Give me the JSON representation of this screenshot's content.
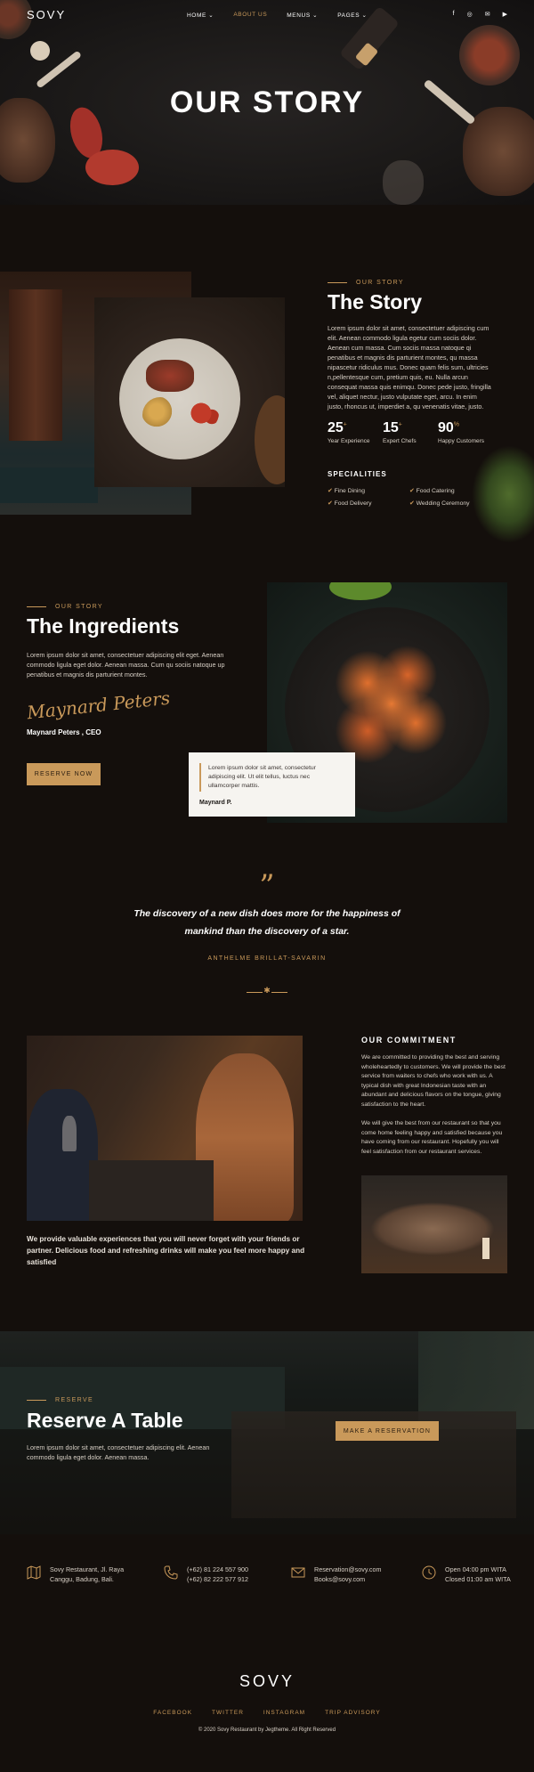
{
  "nav": {
    "logo": "SOVY",
    "items": [
      {
        "label": "HOME ⌄",
        "active": false
      },
      {
        "label": "ABOUT US",
        "active": true
      },
      {
        "label": "MENUS ⌄",
        "active": false
      },
      {
        "label": "PAGES ⌄",
        "active": false
      }
    ],
    "socials": [
      "f",
      "◎",
      "✉",
      "▶"
    ]
  },
  "hero": {
    "title": "OUR STORY"
  },
  "story": {
    "label": "OUR STORY",
    "title": "The Story",
    "text": "Lorem ipsum dolor sit amet, consectetuer adipiscing cum elit. Aenean commodo ligula egetur cum sociis dolor. Aenean cum massa. Cum sociis massa natoque qi penatibus et magnis dis parturient montes, qu massa nipascetur ridiculus mus. Donec quam felis sum, ultricies n,pellentesque cum, pretium quis, eu. Nulla arcun consequat massa quis enimqu. Donec pede justo, fringilla vel, aliquet nectur, justo vulputate eget, arcu. In enim justo, rhoncus ut, imperdiet a, qu venenatis vitae, justo.",
    "stats": [
      {
        "value": "25",
        "suffix": "+",
        "label": "Year Experience"
      },
      {
        "value": "15",
        "suffix": "+",
        "label": "Expert Chefs"
      },
      {
        "value": "90",
        "suffix": "%",
        "label": "Happy Customers"
      }
    ],
    "specialities_title": "SPECIALITIES",
    "specialities": [
      "Fine Dining",
      "Food Catering",
      "Food Delivery",
      "Wedding Ceremony"
    ]
  },
  "ingredients": {
    "label": "OUR STORY",
    "title": "The Ingredients",
    "text": "Lorem ipsum dolor sit amet, consectetuer adipiscing elit eget. Aenean commodo ligula eget dolor. Aenean massa. Cum qu sociis natoque up penatibus et magnis dis parturient montes.",
    "signature": "Maynard Peters",
    "ceo": "Maynard Peters , CEO",
    "button": "RESERVE NOW",
    "card_text": "Lorem ipsum dolor sit amet, consectetur adipiscing elit. Ut elit tellus, luctus nec ullamcorper mattis.",
    "card_author": "Maynard P."
  },
  "quote": {
    "mark": "”",
    "line1": "The discovery of a new dish does more for the happiness of",
    "line2": "mankind than the discovery of a star.",
    "author": "ANTHELME BRILLAT-SAVARIN"
  },
  "commitment": {
    "title": "OUR COMMITMENT",
    "p1": "We are committed to providing the best and serving wholeheartedly to customers. We will provide the best service from waiters to chefs who work with us. A typical dish with great Indonesian taste with an abundant and delicious flavors on the tongue, giving satisfaction to the heart.",
    "p2": "We will give the best from our restaurant so that you come home feeling happy and satisfied because you have coming from our restaurant. Hopefully you will feel satisfaction from our restaurant services.",
    "caption": "We provide valuable experiences that you will never forget with your friends or partner. Delicious food and refreshing drinks will make you feel more happy and satisfied"
  },
  "reserve": {
    "label": "RESERVE",
    "title": "Reserve A Table",
    "text": "Lorem ipsum dolor sit amet, consectetuer adipiscing elit. Aenean commodo ligula eget dolor. Aenean massa.",
    "button": "MAKE A RESERVATION"
  },
  "contact": [
    {
      "icon": "map-icon",
      "line1": "Sovy Restaurant, Jl. Raya",
      "line2": "Canggu, Badung, Bali."
    },
    {
      "icon": "phone-icon",
      "line1": "(+62) 81 224 557 900",
      "line2": "(+62) 82 222 577 912"
    },
    {
      "icon": "mail-icon",
      "line1": "Reservation@sovy.com",
      "line2": "Books@sovy.com"
    },
    {
      "icon": "clock-icon",
      "line1": "Open 04:00 pm WITA",
      "line2": "Closed 01:00 am WITA"
    }
  ],
  "footer": {
    "logo": "SOVY",
    "links": [
      "FACEBOOK",
      "TWITTER",
      "INSTAGRAM",
      "TRIP ADVISORY"
    ],
    "copyright": "© 2020 Sovy Restaurant by Jegtheme. All Right Reserved"
  },
  "colors": {
    "accent": "#c9995a",
    "background": "#140f0c",
    "light_card": "#f6f4f0"
  }
}
